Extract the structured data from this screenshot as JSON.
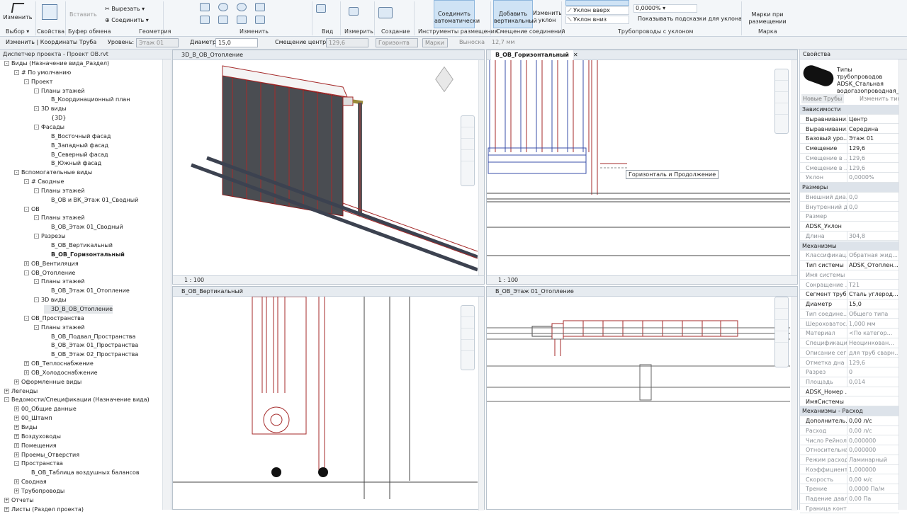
{
  "ribbon": {
    "modify_label": "Изменить",
    "select_label": "Выбор",
    "properties_label": "Свойства",
    "clipboard_label": "Буфер обмена",
    "paste_label": "Вставить",
    "cut_label": "Вырезать",
    "join_label": "Соединить",
    "geometry_label": "Геометрия",
    "modify_panel_label": "Изменить",
    "view_label": "Вид",
    "measure_label": "Измерить",
    "create_label": "Создание",
    "auto_connect_label": "Соединить автоматически",
    "placement_tools_label": "Инструменты размещения",
    "add_vertical_label": "Добавить вертикальный",
    "change_slope_label": "Изменить уклон",
    "offset_connections_label": "Смещение соединений",
    "slope_up_label": "Уклон вверх",
    "slope_down_label": "Уклон вниз",
    "slope_value": "0,0000%",
    "show_hints_label": "Показывать подсказки для уклона",
    "sloped_pipes_label": "Трубопроводы с уклоном",
    "tags_label": "Марки при размещении",
    "mark_label": "Марка"
  },
  "options": {
    "context": "Изменить | Координаты Труба",
    "level_label": "Уровень:",
    "level_value": "Этаж 01",
    "diameter_label": "Диаметр:",
    "diameter_value": "15,0",
    "offset_label": "Смещение центра:",
    "offset_value": "129,6",
    "horizontal_label": "Горизонтв",
    "tag_label": "Марки",
    "height_label": "Выноска",
    "height_value": "12,7 мм"
  },
  "browser": {
    "title": "Диспетчер проекта - Проект ОВ.rvt",
    "rows": [
      {
        "text": "Виды (Назначение вида_Раздел)",
        "lvl": 0,
        "tw": "-"
      },
      {
        "text": "# По умолчанию",
        "lvl": 1,
        "tw": "-"
      },
      {
        "text": "Проект",
        "lvl": 2,
        "tw": "-"
      },
      {
        "text": "Планы этажей",
        "lvl": 3,
        "tw": "-"
      },
      {
        "text": "В_Координационный план",
        "lvl": 4,
        "tw": ""
      },
      {
        "text": "3D виды",
        "lvl": 3,
        "tw": "-"
      },
      {
        "text": "{3D}",
        "lvl": 4,
        "tw": ""
      },
      {
        "text": "Фасады",
        "lvl": 3,
        "tw": "-"
      },
      {
        "text": "В_Восточный фасад",
        "lvl": 4,
        "tw": ""
      },
      {
        "text": "В_Западный фасад",
        "lvl": 4,
        "tw": ""
      },
      {
        "text": "В_Северный фасад",
        "lvl": 4,
        "tw": ""
      },
      {
        "text": "В_Южный фасад",
        "lvl": 4,
        "tw": ""
      },
      {
        "text": "Вспомогательные виды",
        "lvl": 1,
        "tw": "-"
      },
      {
        "text": "# Сводные",
        "lvl": 2,
        "tw": "-"
      },
      {
        "text": "Планы этажей",
        "lvl": 3,
        "tw": "-"
      },
      {
        "text": "В_ОВ и ВК_Этаж 01_Сводный",
        "lvl": 4,
        "tw": ""
      },
      {
        "text": "ОВ",
        "lvl": 2,
        "tw": "-"
      },
      {
        "text": "Планы этажей",
        "lvl": 3,
        "tw": "-"
      },
      {
        "text": "В_ОВ_Этаж 01_Сводный",
        "lvl": 4,
        "tw": ""
      },
      {
        "text": "Разрезы",
        "lvl": 3,
        "tw": "-"
      },
      {
        "text": "В_ОВ_Вертикальный",
        "lvl": 4,
        "tw": ""
      },
      {
        "text": "В_ОВ_Горизонтальный",
        "lvl": 4,
        "tw": "",
        "bold": true
      },
      {
        "text": "ОВ_Вентиляция",
        "lvl": 2,
        "tw": "+"
      },
      {
        "text": "ОВ_Отопление",
        "lvl": 2,
        "tw": "-"
      },
      {
        "text": "Планы этажей",
        "lvl": 3,
        "tw": "-"
      },
      {
        "text": "В_ОВ_Этаж 01_Отопление",
        "lvl": 4,
        "tw": ""
      },
      {
        "text": "3D виды",
        "lvl": 3,
        "tw": "-"
      },
      {
        "text": "3D_В_ОВ_Отопление",
        "lvl": 4,
        "tw": "",
        "sel": true
      },
      {
        "text": "ОВ_Пространства",
        "lvl": 2,
        "tw": "-"
      },
      {
        "text": "Планы этажей",
        "lvl": 3,
        "tw": "-"
      },
      {
        "text": "В_ОВ_Подвал_Пространства",
        "lvl": 4,
        "tw": ""
      },
      {
        "text": "В_ОВ_Этаж 01_Пространства",
        "lvl": 4,
        "tw": ""
      },
      {
        "text": "В_ОВ_Этаж 02_Пространства",
        "lvl": 4,
        "tw": ""
      },
      {
        "text": "ОВ_Теплоснабжение",
        "lvl": 2,
        "tw": "+"
      },
      {
        "text": "ОВ_Холодоснабжение",
        "lvl": 2,
        "tw": "+"
      },
      {
        "text": "Оформленные виды",
        "lvl": 1,
        "tw": "+"
      },
      {
        "text": "Легенды",
        "lvl": 0,
        "tw": "+"
      },
      {
        "text": "Ведомости/Спецификации (Назначение вида)",
        "lvl": 0,
        "tw": "-"
      },
      {
        "text": "00_Общие данные",
        "lvl": 1,
        "tw": "+"
      },
      {
        "text": "00_Штамп",
        "lvl": 1,
        "tw": "+"
      },
      {
        "text": "Виды",
        "lvl": 1,
        "tw": "+"
      },
      {
        "text": "Воздуховоды",
        "lvl": 1,
        "tw": "+"
      },
      {
        "text": "Помещения",
        "lvl": 1,
        "tw": "+"
      },
      {
        "text": "Проемы_Отверстия",
        "lvl": 1,
        "tw": "+"
      },
      {
        "text": "Пространства",
        "lvl": 1,
        "tw": "-"
      },
      {
        "text": "В_ОВ_Таблица воздушных балансов",
        "lvl": 2,
        "tw": ""
      },
      {
        "text": "Сводная",
        "lvl": 1,
        "tw": "+"
      },
      {
        "text": "Трубопроводы",
        "lvl": 1,
        "tw": "+"
      },
      {
        "text": "Отчеты",
        "lvl": 0,
        "tw": "+"
      },
      {
        "text": "Листы (Раздел проекта)",
        "lvl": 0,
        "tw": "+"
      }
    ]
  },
  "views": {
    "v3d_tab": "3D_В_ОВ_Отопление",
    "vh_tab": "В_ОВ_Горизонтальный",
    "vv_tab": "В_ОВ_Вертикальный",
    "vp_tab": "В_ОВ_Этаж 01_Отопление",
    "scale": "1 : 100",
    "tooltip": "Горизонталь и Продолжение"
  },
  "props": {
    "title": "Свойства",
    "type_name": "Типы трубопроводов ADSK_Стальная водогазопроводная_",
    "new_label": "Новые Трубы",
    "edit_type_label": "Изменить тип",
    "rows": [
      {
        "k": "Зависимости",
        "grp": true
      },
      {
        "k": "Выравнивани...",
        "v": "Центр"
      },
      {
        "k": "Выравнивани...",
        "v": "Середина"
      },
      {
        "k": "Базовый уро...",
        "v": "Этаж 01"
      },
      {
        "k": "Смещение",
        "v": "129,6"
      },
      {
        "k": "Смещение в ...",
        "v": "129,6",
        "dim": true
      },
      {
        "k": "Смещение в ...",
        "v": "129,6",
        "dim": true
      },
      {
        "k": "Уклон",
        "v": "0,0000%",
        "dim": true
      },
      {
        "k": "Размеры",
        "grp": true
      },
      {
        "k": "Внешний диа...",
        "v": "0,0",
        "dim": true
      },
      {
        "k": "Внутренний д...",
        "v": "0,0",
        "dim": true
      },
      {
        "k": "Размер",
        "v": "",
        "dim": true
      },
      {
        "k": "ADSK_Уклон",
        "v": ""
      },
      {
        "k": "Длина",
        "v": "304,8",
        "dim": true
      },
      {
        "k": "Механизмы",
        "grp": true
      },
      {
        "k": "Классификац...",
        "v": "Обратная жид...",
        "dim": true
      },
      {
        "k": "Тип системы",
        "v": "ADSK_Отоплен..."
      },
      {
        "k": "Имя системы",
        "v": "",
        "dim": true
      },
      {
        "k": "Сокращение ...",
        "v": "Т21",
        "dim": true
      },
      {
        "k": "Сегмент трубы",
        "v": "Сталь углерод..."
      },
      {
        "k": "Диаметр",
        "v": "15,0"
      },
      {
        "k": "Тип соедине...",
        "v": "Общего типа",
        "dim": true
      },
      {
        "k": "Шероховатос...",
        "v": "1,000 мм",
        "dim": true
      },
      {
        "k": "Материал",
        "v": "<По категор...",
        "dim": true
      },
      {
        "k": "Спецификаци...",
        "v": "Неоцинкован...",
        "dim": true
      },
      {
        "k": "Описание сег...",
        "v": "для труб сварн...",
        "dim": true
      },
      {
        "k": "Отметка дна",
        "v": "129,6",
        "dim": true
      },
      {
        "k": "Разрез",
        "v": "0",
        "dim": true
      },
      {
        "k": "Площадь",
        "v": "0,014",
        "dim": true
      },
      {
        "k": "ADSK_Номер ...",
        "v": ""
      },
      {
        "k": "ИмяСистемы",
        "v": ""
      },
      {
        "k": "Механизмы - Расход",
        "grp": true
      },
      {
        "k": "Дополнитель...",
        "v": "0,00 л/с"
      },
      {
        "k": "Расход",
        "v": "0,00 л/с",
        "dim": true
      },
      {
        "k": "Число Рейнол...",
        "v": "0,000000",
        "dim": true
      },
      {
        "k": "Относительна...",
        "v": "0,000000",
        "dim": true
      },
      {
        "k": "Режим расхода",
        "v": "Ламинарный",
        "dim": true
      },
      {
        "k": "Коэффициент...",
        "v": "1,000000",
        "dim": true
      },
      {
        "k": "Скорость",
        "v": "0,00 м/с",
        "dim": true
      },
      {
        "k": "Трение",
        "v": "0,0000 Па/м",
        "dim": true
      },
      {
        "k": "Падение давл...",
        "v": "0,00 Па",
        "dim": true
      },
      {
        "k": "Граница конт...",
        "v": "",
        "dim": true
      }
    ]
  }
}
